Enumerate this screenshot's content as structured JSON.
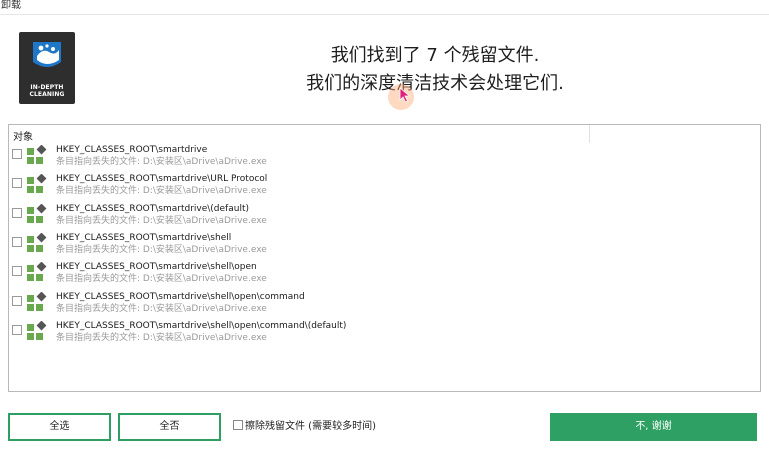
{
  "window": {
    "title": "卸载"
  },
  "logo": {
    "line1": "IN-DEPTH",
    "line2": "CLEANING"
  },
  "headline": {
    "line1": "我们找到了 7 个残留文件.",
    "line2": "我们的深度清洁技术会处理它们."
  },
  "list": {
    "header": "对象",
    "items": [
      {
        "title": "HKEY_CLASSES_ROOT\\smartdrive",
        "subtitle": "条目指向丢失的文件: D:\\安装区\\aDrive\\aDrive.exe"
      },
      {
        "title": "HKEY_CLASSES_ROOT\\smartdrive\\URL Protocol",
        "subtitle": "条目指向丢失的文件: D:\\安装区\\aDrive\\aDrive.exe"
      },
      {
        "title": "HKEY_CLASSES_ROOT\\smartdrive\\(default)",
        "subtitle": "条目指向丢失的文件: D:\\安装区\\aDrive\\aDrive.exe"
      },
      {
        "title": "HKEY_CLASSES_ROOT\\smartdrive\\shell",
        "subtitle": "条目指向丢失的文件: D:\\安装区\\aDrive\\aDrive.exe"
      },
      {
        "title": "HKEY_CLASSES_ROOT\\smartdrive\\shell\\open",
        "subtitle": "条目指向丢失的文件: D:\\安装区\\aDrive\\aDrive.exe"
      },
      {
        "title": "HKEY_CLASSES_ROOT\\smartdrive\\shell\\open\\command",
        "subtitle": "条目指向丢失的文件: D:\\安装区\\aDrive\\aDrive.exe"
      },
      {
        "title": "HKEY_CLASSES_ROOT\\smartdrive\\shell\\open\\command\\(default)",
        "subtitle": "条目指向丢失的文件: D:\\安装区\\aDrive\\aDrive.exe"
      }
    ]
  },
  "buttons": {
    "select_all": "全选",
    "select_none": "全否",
    "erase_label": "擦除残留文件 (需要较多时间)",
    "no_thanks": "不, 谢谢"
  },
  "colors": {
    "accent": "#2ea063",
    "icon_green": "#6aa84f",
    "icon_dark": "#555555"
  }
}
